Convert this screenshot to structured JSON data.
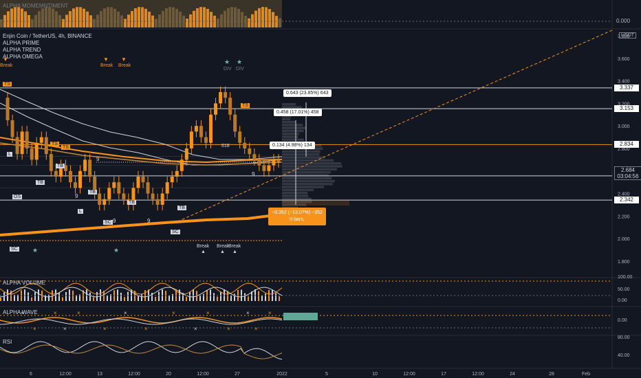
{
  "symbol": {
    "title": "Enjin Coin / TetherUS, 4h, BINANCE"
  },
  "indicators": [
    "ALPHA PRIME",
    "ALPHA TREND",
    "ALPHA OMEGA"
  ],
  "panes": {
    "momentum": {
      "title": "ALPHA MOMEMNTIMENT",
      "axis": [
        "0.000"
      ]
    },
    "volume": {
      "title": "ALPHA VOLUME",
      "axis": [
        "100.00",
        "50.00",
        "0.00"
      ]
    },
    "wave": {
      "title": "ALPHA WAVE",
      "axis": [
        "0.00"
      ]
    },
    "rsi": {
      "title": "RSI",
      "axis": [
        "80.00",
        "40.00"
      ]
    }
  },
  "currency": "USDT",
  "price_axis": {
    "ticks": [
      "3.800",
      "3.600",
      "3.400",
      "3.200",
      "3.000",
      "2.800",
      "2.600",
      "2.400",
      "2.200",
      "2.000",
      "1.800"
    ],
    "tags": [
      {
        "text": "3.337",
        "price": 3.337
      },
      {
        "text": "3.153",
        "price": 3.153
      },
      {
        "text": "2.834",
        "price": 2.834
      },
      {
        "text": "2.557",
        "price": 2.557
      },
      {
        "text": "2.342",
        "price": 2.342
      }
    ],
    "current": {
      "price": "2.684",
      "countdown": "03:04:56"
    }
  },
  "time_axis": [
    "6",
    "12:00",
    "13",
    "12:00",
    "20",
    "12:00",
    "27",
    "2022",
    "5",
    "10",
    "12:00",
    "17",
    "12:00",
    "24",
    "28",
    "Feb"
  ],
  "measurements": [
    {
      "text": "0.643 (23.85%) 643"
    },
    {
      "text": "0.458 (17.01%) 458"
    },
    {
      "text": "0.134 (4.98%) 134"
    }
  ],
  "measure_down": {
    "line1": "−0.352 (−13.07%) −352",
    "line2": "0 bars,"
  },
  "markers": {
    "break_top": [
      "Break",
      "Break",
      "Break"
    ],
    "div": [
      "DIV",
      "DIV"
    ],
    "break_bottom": [
      "Break",
      "Break",
      "Break"
    ],
    "nine": "9",
    "fib": "618",
    "l": "L",
    "os": "OS",
    "sc": "SC",
    "tb": "TB",
    "ts": "TS"
  },
  "colors": {
    "bg": "#131722",
    "orange": "#f7931a",
    "gray": "#787b86",
    "text": "#d1d4dc"
  },
  "chart_data": {
    "type": "candlestick",
    "title": "Enjin Coin / TetherUS, 4h, BINANCE",
    "ylim": [
      1.75,
      4.0
    ],
    "levels": [
      3.337,
      3.153,
      2.834,
      2.557,
      2.342
    ],
    "current_price": 2.684,
    "close_series": [
      3.25,
      3.05,
      2.9,
      2.75,
      2.95,
      2.8,
      2.7,
      2.85,
      2.9,
      2.75,
      2.6,
      2.55,
      2.65,
      2.6,
      2.5,
      2.45,
      2.6,
      2.7,
      2.55,
      2.4,
      2.3,
      2.35,
      2.45,
      2.5,
      2.4,
      2.35,
      2.3,
      2.45,
      2.55,
      2.5,
      2.4,
      2.35,
      2.3,
      2.4,
      2.5,
      2.55,
      2.6,
      2.7,
      2.8,
      2.95,
      3.0,
      2.9,
      2.85,
      3.1,
      3.2,
      3.3,
      3.25,
      3.1,
      2.95,
      2.85,
      2.8,
      2.75,
      2.7,
      2.65,
      2.6,
      2.65,
      2.7,
      2.68
    ]
  }
}
